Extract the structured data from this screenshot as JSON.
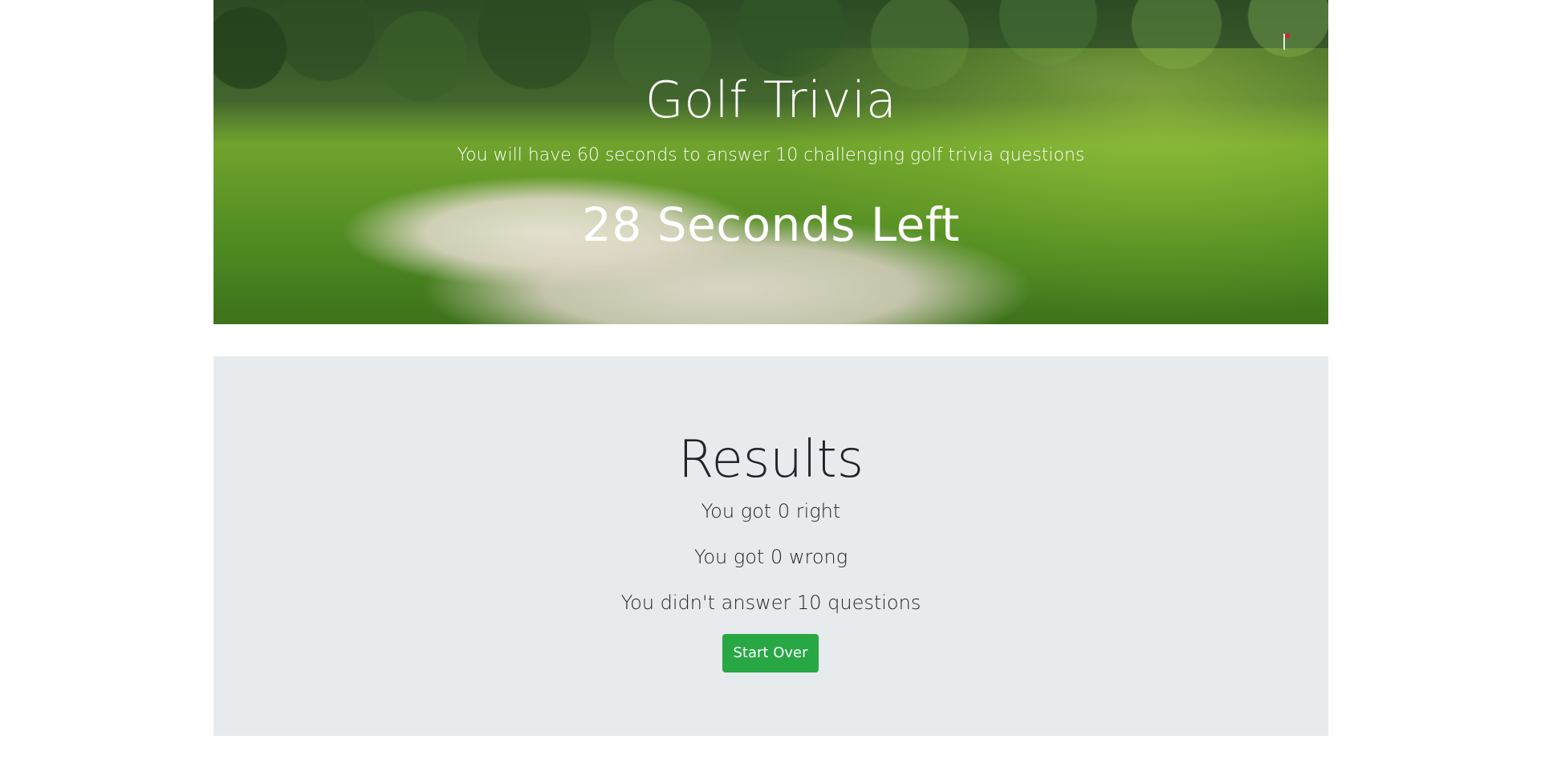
{
  "header": {
    "title": "Golf Trivia",
    "subtitle": "You will have 60 seconds to answer 10 challenging golf trivia questions",
    "timer_text": "28 Seconds Left"
  },
  "results": {
    "title": "Results",
    "right_text": "You got 0 right",
    "wrong_text": "You got 0 wrong",
    "unanswered_text": "You didn't answer 10 questions",
    "start_over_label": "Start Over"
  },
  "colors": {
    "button_bg": "#28a745",
    "results_bg": "#e8ebee",
    "text_dark": "#212529"
  }
}
